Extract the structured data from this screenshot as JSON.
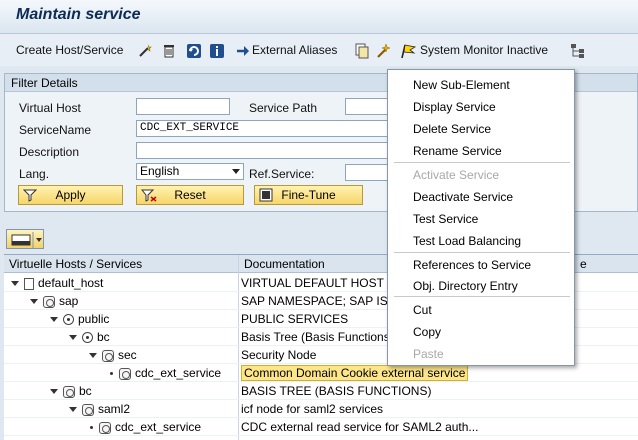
{
  "window": {
    "title": "Maintain service"
  },
  "toolbar": {
    "create_host_service": "Create Host/Service",
    "external_aliases": "External Aliases",
    "system_monitor_inactive": "System Monitor Inactive"
  },
  "filter": {
    "section_title": "Filter Details",
    "virtual_host_label": "Virtual Host",
    "virtual_host_value": "",
    "service_path_label": "Service Path",
    "service_path_value": "",
    "service_name_label": "ServiceName",
    "service_name_value": "CDC_EXT_SERVICE",
    "description_label": "Description",
    "description_value": "",
    "lang_label": "Lang.",
    "lang_value": "English",
    "ref_service_label": "Ref.Service:",
    "ref_service_value": "",
    "apply": "Apply",
    "reset": "Reset",
    "fine_tune": "Fine-Tune"
  },
  "tree": {
    "col1": "Virtuelle Hosts / Services",
    "col2": "Documentation",
    "col3": "e",
    "rows": [
      {
        "name": "default_host",
        "doc": "VIRTUAL DEFAULT HOST"
      },
      {
        "name": "sap",
        "doc": "SAP NAMESPACE; SAP IS O"
      },
      {
        "name": "public",
        "doc": "PUBLIC SERVICES"
      },
      {
        "name": "bc",
        "doc": "Basis Tree (Basis Functions"
      },
      {
        "name": "sec",
        "doc": "Security Node"
      },
      {
        "name": "cdc_ext_service",
        "doc": "Common Domain Cookie external service"
      },
      {
        "name": "bc",
        "doc": "BASIS TREE (BASIS FUNCTIONS)"
      },
      {
        "name": "saml2",
        "doc": "icf node for saml2 services"
      },
      {
        "name": "cdc_ext_service",
        "doc": "CDC external read service for SAML2 auth..."
      }
    ]
  },
  "context_menu": {
    "new_sub_element": "New Sub-Element",
    "display_service": "Display Service",
    "delete_service": "Delete Service",
    "rename_service": "Rename Service",
    "activate_service": "Activate Service",
    "deactivate_service": "Deactivate Service",
    "test_service": "Test Service",
    "test_load_balancing": "Test Load Balancing",
    "references_to_service": "References to Service",
    "obj_directory_entry": "Obj. Directory Entry",
    "cut": "Cut",
    "copy": "Copy",
    "paste": "Paste"
  },
  "colors": {
    "title_text": "#0c2b55",
    "button_yellow": "#f7d66b",
    "highlight": "#fde58a",
    "disabled_text": "#a8a8a8"
  }
}
